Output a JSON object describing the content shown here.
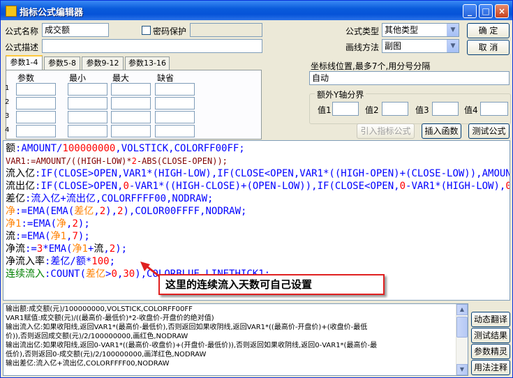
{
  "window": {
    "title": "指标公式编辑器",
    "buttons": {
      "minimize": "_",
      "maximize": "□",
      "close": "×"
    }
  },
  "form": {
    "name_label": "公式名称",
    "name_value": "成交额",
    "password_label": "密码保护",
    "desc_label": "公式描述",
    "desc_value": "",
    "type_label": "公式类型",
    "type_value": "其他类型",
    "draw_label": "画线方法",
    "draw_value": "副图",
    "ok": "确  定",
    "cancel": "取  消"
  },
  "params": {
    "tabs": [
      "参数1-4",
      "参数5-8",
      "参数9-12",
      "参数13-16"
    ],
    "headers": [
      "参数",
      "最小",
      "最大",
      "缺省"
    ],
    "rows": [
      "1",
      "2",
      "3",
      "4"
    ]
  },
  "coords": {
    "label": "坐标线位置,最多7个,用分号分隔",
    "value": "自动",
    "group_title": "额外Y轴分界",
    "values": [
      "值1",
      "值2",
      "值3",
      "值4"
    ]
  },
  "actions": {
    "import": "引入指标公式",
    "insert": "插入函数",
    "test": "测试公式"
  },
  "code": {
    "l1": {
      "a": "额",
      "b": ":AMOUNT/",
      "c": "100000000",
      "d": ",VOLSTICK,COLORFF00FF;"
    },
    "l2": {
      "a": "VAR1:=AMOUNT/((HIGH-LOW)*",
      "b": "2",
      "c": "-ABS(CLOSE-OPEN));"
    },
    "l3": {
      "a": "流入亿",
      "b": ":IF(CLOSE>OPEN,VAR1*(HIGH-LOW),IF(CLOSE<OPEN,VAR1*((HIGH-OPEN)+(CLOSE-LOW)),AMOUNT/"
    },
    "l4": {
      "a": "流出亿",
      "b": ":IF(CLOSE>OPEN,",
      "c": "0",
      "d": "-VAR1*((HIGH-CLOSE)+(OPEN-LOW)),IF(CLOSE<OPEN,",
      "e": "0",
      "f": "-VAR1*(HIGH-LOW),",
      "g": "0",
      "h": "-A"
    },
    "l5": {
      "a": "差亿",
      "b": ":流入亿+流出亿,COLORFFFF00,NODRAW;"
    },
    "l6": {
      "a": "净",
      "b": ":=EMA(EMA(",
      "c": "差亿",
      "d": ",",
      "e": "2",
      "f": "),",
      "g": "2",
      "h": "),COLOR00FFFF,NODRAW;"
    },
    "l7": {
      "a": "净1",
      "b": ":=EMA(",
      "c": "净",
      "d": ",",
      "e": "2",
      "f": ");"
    },
    "l8": {
      "a": "流",
      "b": ":=EMA(",
      "c": "净1",
      "d": ",",
      "e": "7",
      "f": ");"
    },
    "l9": {
      "a": "净流",
      "b": ":=",
      "c": "3",
      "d": "*EMA(",
      "e": "净1",
      "f": "+",
      "g": "流",
      "h": ",",
      "i": "2",
      "j": ");"
    },
    "l10": {
      "a": "净流入率",
      "b": ":差亿/额*",
      "c": "100",
      "d": ";"
    },
    "l11": {
      "a": "连续流入",
      "b": ":COUNT(",
      "c": "差亿",
      "d": ">",
      "e": "0",
      "f": ",",
      "g": "30",
      "h": "),COLORBLUE,LINETHICK1;"
    }
  },
  "callout": "这里的连续流入天数可自己设置",
  "output": [
    "输出额:成交额(元)/100000000,VOLSTICK,COLORFF00FF",
    "VAR1赋值:成交额(元)/((最高价-最低价)*2-收盘价-开盘价的绝对值)",
    "输出流入亿:如果收阳线,返回VAR1*(最高价-最低价),否则返回如果收阴线,返回VAR1*((最高价-开盘价)+(收盘价-最低",
    "价)),否则返回成交额(元)/2/100000000,画红色,NODRAW",
    "输出流出亿:如果收阳线,返回0-VAR1*((最高价-收盘价)+(开盘价-最低价)),否则返回如果收阴线,返回0-VAR1*(最高价-最",
    "低价),否则返回0-成交额(元)/2/100000000,画洋红色,NODRAW",
    "输出差亿:流入亿+流出亿,COLORFFFF00,NODRAW"
  ],
  "side_buttons": [
    "动态翻译",
    "测试结果",
    "参数精灵",
    "用法注释"
  ]
}
